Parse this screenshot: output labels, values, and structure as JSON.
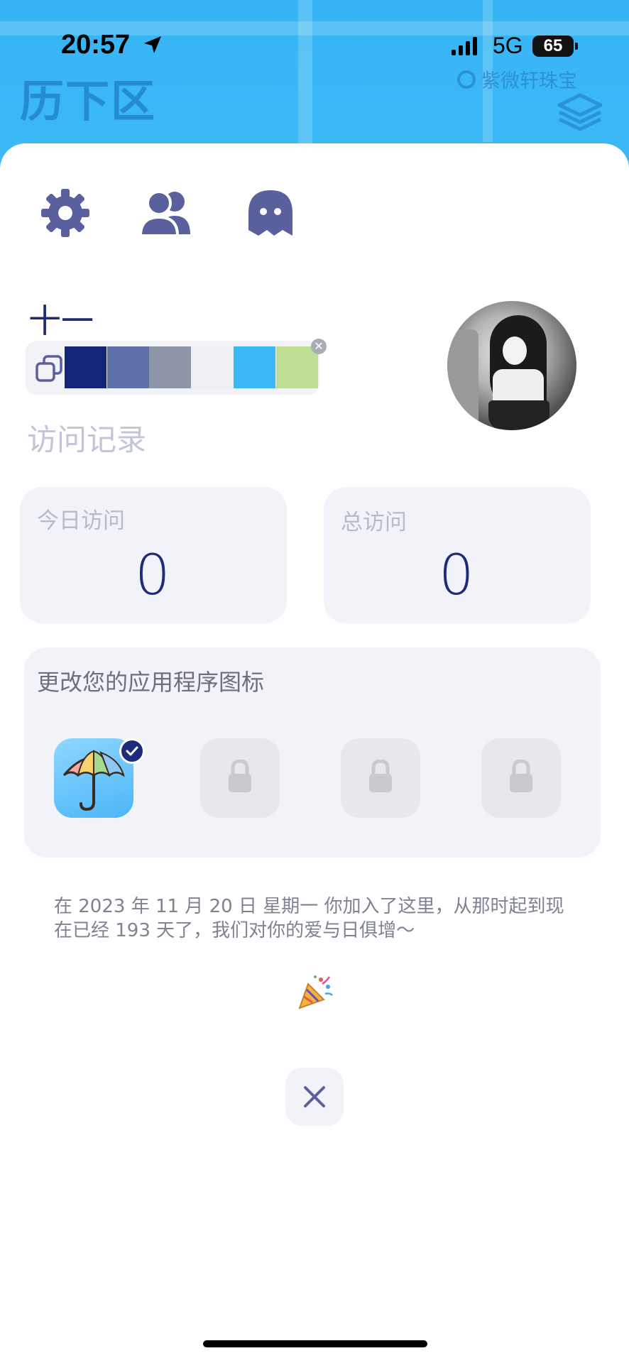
{
  "status_bar": {
    "time": "20:57",
    "network": "5G",
    "battery": "65"
  },
  "map": {
    "district": "历下区",
    "poi": "紫微轩珠宝"
  },
  "profile": {
    "name": "十一",
    "palette": [
      "#14267a",
      "#5f6fa8",
      "#8f96aa",
      "#eef0f3",
      "#3ab9f4",
      "#bdde93"
    ]
  },
  "visits": {
    "section_title": "访问记录",
    "today_label": "今日访问",
    "today_value": "0",
    "total_label": "总访问",
    "total_value": "0"
  },
  "app_icons": {
    "title": "更改您的应用程序图标",
    "items": [
      {
        "state": "selected",
        "icon": "umbrella-icon"
      },
      {
        "state": "locked",
        "icon": "lock-icon"
      },
      {
        "state": "locked",
        "icon": "lock-icon"
      },
      {
        "state": "locked",
        "icon": "lock-icon"
      }
    ]
  },
  "joined_message": "在 2023 年 11 月 20 日 星期一 你加入了这里，从那时起到现在已经 193 天了，我们对你的爱与日俱增～",
  "colors": {
    "accent": "#1d2b7a",
    "icon_purple": "#5a5f9e",
    "map_blue": "#3ab8f5"
  }
}
